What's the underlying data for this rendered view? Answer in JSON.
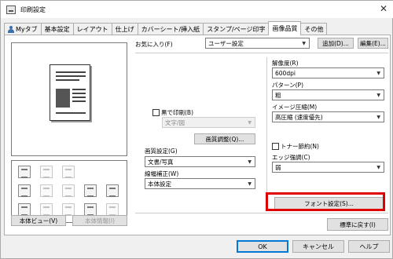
{
  "window": {
    "title": "印刷設定",
    "close_glyph": "✕"
  },
  "tabs": [
    {
      "label": "Myタブ",
      "icon": "person-icon"
    },
    {
      "label": "基本設定"
    },
    {
      "label": "レイアウト"
    },
    {
      "label": "仕上げ"
    },
    {
      "label": "カバーシート/挿入紙"
    },
    {
      "label": "スタンプ/ページ印字"
    },
    {
      "label": "画像品質",
      "active": true
    },
    {
      "label": "その他"
    }
  ],
  "favorites": {
    "label": "お気に入り(F)",
    "value": "ユーザー設定",
    "add_button": "追加(D)...",
    "edit_button": "編集(E)..."
  },
  "left_buttons": {
    "view": "本体ビュー(V)",
    "info": "本体情報(I)"
  },
  "middle": {
    "black_print_label": "黒で印刷(B)",
    "black_print_select": "文字/図",
    "image_adjust_button": "画質調整(Q)...",
    "quality_label": "画質設定(G)",
    "quality_value": "文書/写真",
    "line_label": "線幅補正(W)",
    "line_value": "本体設定"
  },
  "right": {
    "resolution_label": "解像度(R)",
    "resolution_value": "600dpi",
    "pattern_label": "パターン(P)",
    "pattern_value": "粗",
    "compression_label": "イメージ圧縮(M)",
    "compression_value": "高圧縮 (速度優先)",
    "toner_label": "トナー節約(N)",
    "edge_label": "エッジ強調(C)",
    "edge_value": "弱",
    "font_button": "フォント設定(S)..."
  },
  "restore_button": "標準に戻す(I)",
  "footer": {
    "ok": "OK",
    "cancel": "キャンセル",
    "help": "ヘルプ"
  },
  "colors": {
    "highlight": "#e00000",
    "focus": "#0078d7"
  }
}
